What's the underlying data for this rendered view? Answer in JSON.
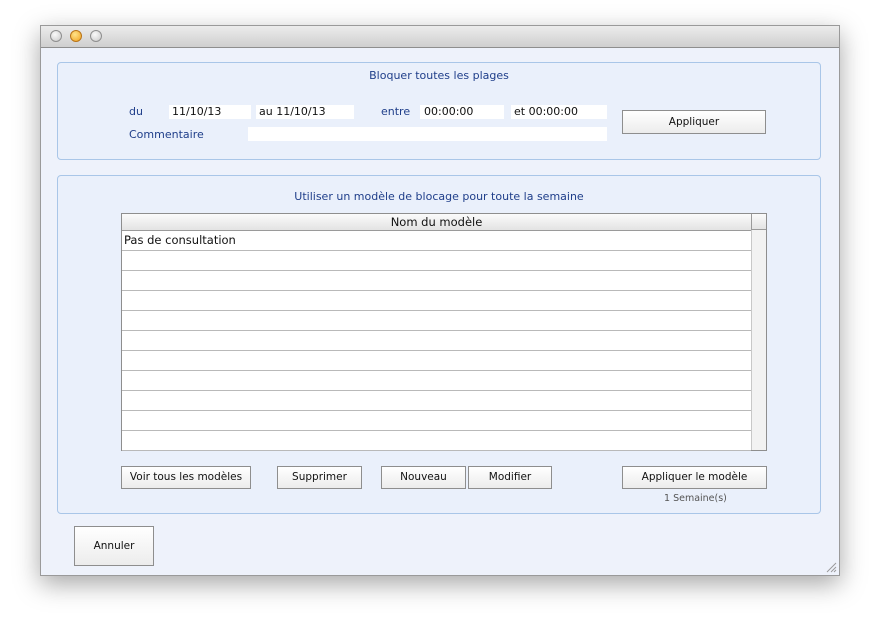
{
  "block_all": {
    "title": "Bloquer toutes les plages",
    "from_label": "du",
    "from_value": "11/10/13",
    "to_value": "au 11/10/13",
    "between_label": "entre",
    "start_time": "00:00:00",
    "end_time": "et 00:00:00",
    "comment_label": "Commentaire",
    "comment_value": "",
    "apply_label": "Appliquer"
  },
  "template_section": {
    "title": "Utiliser un modèle de blocage pour toute la semaine",
    "table": {
      "column": "Nom du modèle",
      "rows": [
        "Pas de consultation",
        "",
        "",
        "",
        "",
        "",
        "",
        "",
        "",
        "",
        ""
      ]
    },
    "buttons": {
      "view_all": "Voir tous les modèles",
      "delete": "Supprimer",
      "new": "Nouveau",
      "edit": "Modifier",
      "apply_template": "Appliquer le modèle"
    },
    "week_count": "1 Semaine(s)"
  },
  "cancel_label": "Annuler"
}
